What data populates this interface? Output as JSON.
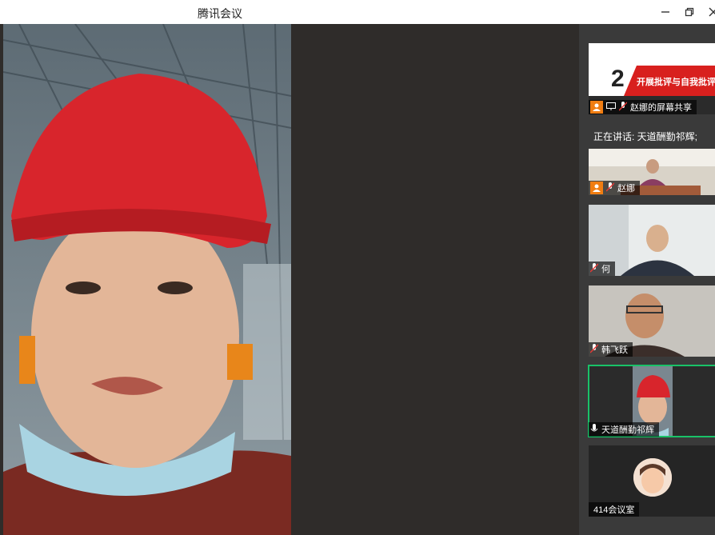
{
  "window": {
    "title": "腾讯会议",
    "controls": {
      "minimize": "minimize-icon",
      "maximize": "restore-icon",
      "close": "close-icon"
    }
  },
  "main_video": {
    "participant": "天道酬勤祁辉",
    "icon": "person-video-feed"
  },
  "panel": {
    "speaking_note": "正在讲话: 天道酬勤祁辉;",
    "tiles": [
      {
        "name": "赵娜的屏幕共享",
        "kind": "screen-share",
        "slide_number": "2",
        "slide_title": "开展批评与自我批评",
        "has_host_badge": true
      },
      {
        "name": "赵娜",
        "kind": "video",
        "has_host_badge": true
      },
      {
        "name": "何",
        "kind": "video",
        "has_host_badge": false
      },
      {
        "name": "韩飞跃",
        "kind": "video",
        "has_host_badge": false
      },
      {
        "name": "天道酬勤祁辉",
        "kind": "video",
        "active": true,
        "has_host_badge": false
      },
      {
        "name": "414会议室",
        "kind": "avatar",
        "has_host_badge": false
      }
    ]
  },
  "colors": {
    "accent_green": "#19c268",
    "host_orange": "#f07d12",
    "slide_red": "#d8201e"
  }
}
